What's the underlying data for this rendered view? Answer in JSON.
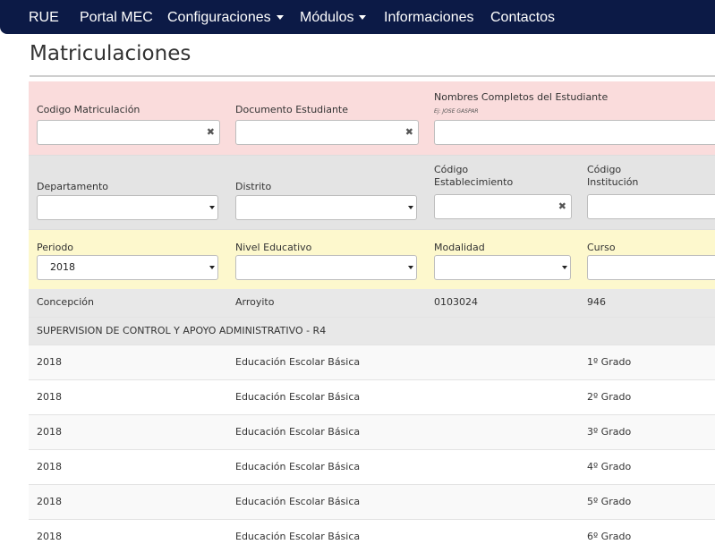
{
  "nav": {
    "brand": "RUE",
    "items": [
      {
        "label": "Portal MEC",
        "dropdown": false
      },
      {
        "label": "Configuraciones",
        "dropdown": true
      },
      {
        "label": "Módulos",
        "dropdown": true
      },
      {
        "label": "Informaciones",
        "dropdown": false
      },
      {
        "label": "Contactos",
        "dropdown": false
      }
    ]
  },
  "page_title": "Matriculaciones",
  "filters": {
    "codigo_matriculacion": {
      "label": "Codigo Matriculación",
      "value": ""
    },
    "documento_estudiante": {
      "label": "Documento Estudiante",
      "value": ""
    },
    "nombres_completos": {
      "label": "Nombres Completos del Estudiante",
      "hint": "Ej: JOSE GASPAR",
      "value": ""
    },
    "departamento": {
      "label": "Departamento",
      "value": ""
    },
    "distrito": {
      "label": "Distrito",
      "value": ""
    },
    "codigo_establecimiento": {
      "label_line1": "Código",
      "label_line2": "Establecimiento",
      "value": ""
    },
    "codigo_institucion": {
      "label_line1": "Código",
      "label_line2": "Institución",
      "value": ""
    },
    "periodo": {
      "label": "Periodo",
      "value": "2018"
    },
    "nivel_educativo": {
      "label": "Nivel Educativo",
      "value": ""
    },
    "modalidad": {
      "label": "Modalidad",
      "value": ""
    },
    "curso": {
      "label": "Curso",
      "value": ""
    }
  },
  "summary": {
    "departamento": "Concepción",
    "distrito": "Arroyito",
    "codigo_establecimiento": "0103024",
    "codigo_institucion": "946",
    "institucion": "SUPERVISION DE CONTROL Y APOYO ADMINISTRATIVO - R4"
  },
  "rows": [
    {
      "periodo": "2018",
      "nivel": "Educación Escolar Básica",
      "modalidad": "",
      "curso": "1º Grado"
    },
    {
      "periodo": "2018",
      "nivel": "Educación Escolar Básica",
      "modalidad": "",
      "curso": "2º Grado"
    },
    {
      "periodo": "2018",
      "nivel": "Educación Escolar Básica",
      "modalidad": "",
      "curso": "3º Grado"
    },
    {
      "periodo": "2018",
      "nivel": "Educación Escolar Básica",
      "modalidad": "",
      "curso": "4º Grado"
    },
    {
      "periodo": "2018",
      "nivel": "Educación Escolar Básica",
      "modalidad": "",
      "curso": "5º Grado"
    },
    {
      "periodo": "2018",
      "nivel": "Educación Escolar Básica",
      "modalidad": "",
      "curso": "6º Grado"
    }
  ],
  "colors": {
    "navbar": "#0c1a46",
    "band_pink": "#fadcdc",
    "band_gray": "#e4e4e4",
    "band_yellow": "#fdf8cd",
    "row_alt": "#f9f9f9"
  },
  "icons": {
    "clear": "clear-x-icon",
    "dropdown": "chevron-down-icon"
  }
}
